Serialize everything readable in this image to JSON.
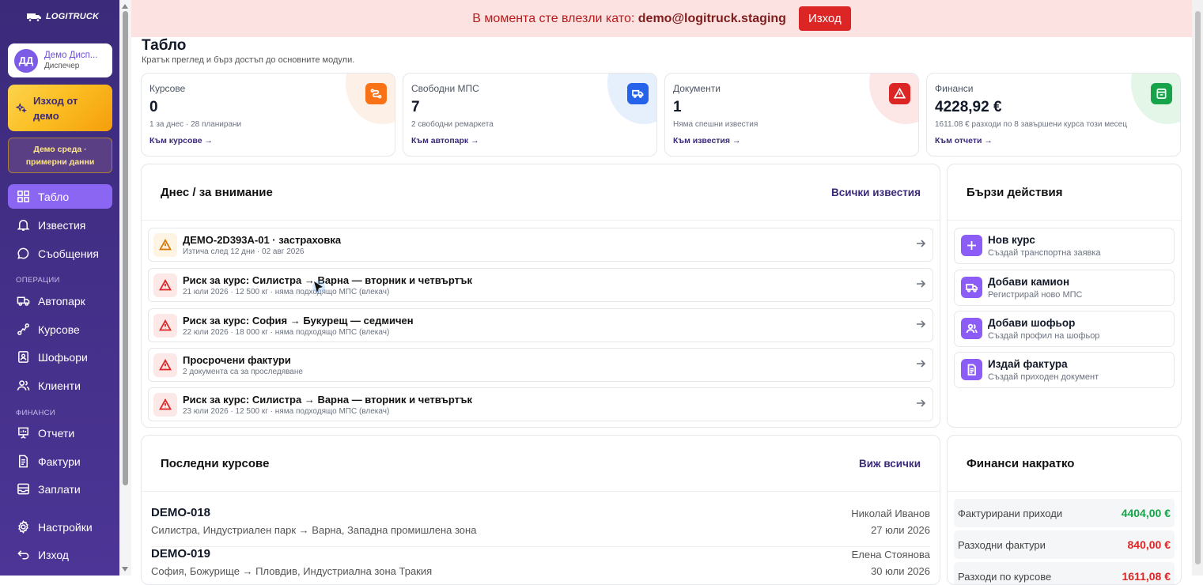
{
  "brand": "LOGITRUCK",
  "user": {
    "initials": "ДД",
    "name": "Демо Дисп...",
    "role": "Диспечер"
  },
  "exit_demo": "Изход от демо",
  "demo_env": [
    "Демо среда ·",
    "примерни данни"
  ],
  "nav": {
    "dashboard": "Табло",
    "notifications": "Известия",
    "messages": "Съобщения",
    "section_ops": "ОПЕРАЦИИ",
    "fleet": "Автопарк",
    "trips": "Курсове",
    "drivers": "Шофьори",
    "clients": "Клиенти",
    "section_fin": "ФИНАНСИ",
    "reports": "Отчети",
    "invoices": "Фактури",
    "salaries": "Заплати",
    "settings": "Настройки",
    "logout": "Изход"
  },
  "banner": {
    "text": "В момента сте влезли като:",
    "email": "demo@logitruck.staging",
    "button": "Изход"
  },
  "page": {
    "title": "Табло",
    "subtitle": "Кратък преглед и бърз достъп до основните модули."
  },
  "stats": [
    {
      "label": "Курсове",
      "value": "0",
      "sub": "1 за днес · 28 планирани",
      "link": "Към курсове",
      "color": "#f97316",
      "blob": "#fdf0e6"
    },
    {
      "label": "Свободни МПС",
      "value": "7",
      "sub": "2 свободни ремаркета",
      "link": "Към автопарк",
      "color": "#2563eb",
      "blob": "#e6effc"
    },
    {
      "label": "Документи",
      "value": "1",
      "sub": "Няма спешни известия",
      "link": "Към известия",
      "color": "#dc2626",
      "blob": "#fde6e6"
    },
    {
      "label": "Финанси",
      "value": "4228,92 €",
      "sub": "1611.08 € разходи по 8 завършени курса този месец",
      "link": "Към отчети",
      "color": "#16a34a",
      "blob": "#e3f6e8"
    }
  ],
  "attention": {
    "title": "Днес / за внимание",
    "action": "Всички известия",
    "items": [
      {
        "title": "ДЕМО-2D393A-01 · застраховка",
        "sub": "Изтича след 12 дни · 02 авг 2026",
        "level": "warn"
      },
      {
        "title": "Риск за курс: Силистра → Варна — вторник и четвъртък",
        "sub": "21 юли 2026 · 12 500 кг · няма подходящо МПС (влекач)",
        "level": "danger"
      },
      {
        "title": "Риск за курс: София → Букурещ — седмичен",
        "sub": "22 юли 2026 · 18 000 кг · няма подходящо МПС (влекач)",
        "level": "danger"
      },
      {
        "title": "Просрочени фактури",
        "sub": "2 документа са за проследяване",
        "level": "danger"
      },
      {
        "title": "Риск за курс: Силистра → Варна — вторник и четвъртък",
        "sub": "23 юли 2026 · 12 500 кг · няма подходящо МПС (влекач)",
        "level": "danger"
      }
    ]
  },
  "quick": {
    "title": "Бързи действия",
    "items": [
      {
        "title": "Нов курс",
        "sub": "Създай транспортна заявка",
        "icon": "plus-icon"
      },
      {
        "title": "Добави камион",
        "sub": "Регистрирай ново МПС",
        "icon": "truck-icon"
      },
      {
        "title": "Добави шофьор",
        "sub": "Създай профил на шофьор",
        "icon": "users-icon"
      },
      {
        "title": "Издай фактура",
        "sub": "Създай приходен документ",
        "icon": "document-icon"
      }
    ]
  },
  "recent": {
    "title": "Последни курсове",
    "action": "Виж всички",
    "items": [
      {
        "id": "DEMO-018",
        "route": "Силистра, Индустриален парк → Варна, Западна промишлена зона",
        "driver": "Николай Иванов",
        "date": "27 юли 2026"
      },
      {
        "id": "DEMO-019",
        "route": "София, Божурище → Пловдив, Индустриална зона Тракия",
        "driver": "Елена Стоянова",
        "date": "30 юли 2026"
      }
    ]
  },
  "finance": {
    "title": "Финанси накратко",
    "items": [
      {
        "label": "Фактурирани приходи",
        "value": "4404,00 €",
        "color": "#16a34a"
      },
      {
        "label": "Разходни фактури",
        "value": "840,00 €",
        "color": "#dc2626"
      },
      {
        "label": "Разходи по курсове",
        "value": "1611,08 €",
        "color": "#dc2626"
      }
    ]
  }
}
